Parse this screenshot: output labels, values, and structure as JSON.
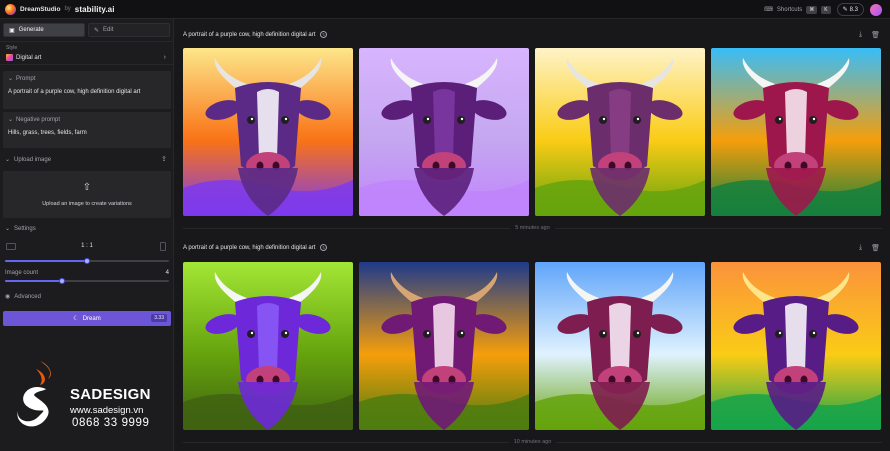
{
  "app": {
    "name": "DreamStudio",
    "by": "by",
    "brand": "stability.ai"
  },
  "topbar": {
    "shortcuts_label": "Shortcuts",
    "shortcut_keys": [
      "⌘",
      "K"
    ],
    "credits": "8.3"
  },
  "sidebar": {
    "tabs": [
      {
        "label": "Generate",
        "icon": "image-icon",
        "active": true
      },
      {
        "label": "Edit",
        "icon": "edit-icon",
        "active": false
      }
    ],
    "style": {
      "label": "Style",
      "value": "Digital art"
    },
    "prompt": {
      "label": "Prompt",
      "value": "A portrait of a purple cow, high definition digital art"
    },
    "negative_prompt": {
      "label": "Negative prompt",
      "value": "Hills, grass, trees, fields, farm"
    },
    "upload": {
      "label": "Upload image",
      "hint": "Upload an image to create variations"
    },
    "settings": {
      "label": "Settings",
      "aspect_ratio": "1 : 1",
      "aspect_ratio_fraction": 0.5,
      "image_count_label": "Image count",
      "image_count": "4",
      "image_count_fraction": 0.35
    },
    "advanced_label": "Advanced",
    "dream_button": {
      "label": "Dream",
      "cost": "3.33"
    }
  },
  "watermark": {
    "brand": "SADESIGN",
    "website": "www.sadesign.vn",
    "phone": "0868 33 9999"
  },
  "generations": [
    {
      "prompt": "A portrait of a purple cow, high definition digital art",
      "time": "5 minutes ago",
      "images": [
        {
          "bg": [
            "#fde68a",
            "#f97316",
            "#7c3aed"
          ],
          "cow": "#5b2a86",
          "face": "#ffffff",
          "horn": "#e7e5e4"
        },
        {
          "bg": [
            "#d8b4fe",
            "#c4a7f0",
            "#c084fc"
          ],
          "cow": "#5b1f7a",
          "face": "#7e3aa5",
          "horn": "#f5f5f4"
        },
        {
          "bg": [
            "#fef3c7",
            "#facc15",
            "#65a30d"
          ],
          "cow": "#6b2d6b",
          "face": "#8b3f86",
          "horn": "#e7e5e4"
        },
        {
          "bg": [
            "#38bdf8",
            "#f59e0b",
            "#15803d"
          ],
          "cow": "#9d174d",
          "face": "#fdf2f8",
          "horn": "#f5f5f4"
        }
      ]
    },
    {
      "prompt": "A portrait of a purple cow, high definition digital art",
      "time": "10 minutes ago",
      "images": [
        {
          "bg": [
            "#a3e635",
            "#65a30d",
            "#3f6212"
          ],
          "cow": "#6d28d9",
          "face": "#8b5cf6",
          "horn": "#f5f5f4"
        },
        {
          "bg": [
            "#1e3a8a",
            "#f59e0b",
            "#4d7c0f"
          ],
          "cow": "#701a75",
          "face": "#fce7f3",
          "horn": "#d6a574"
        },
        {
          "bg": [
            "#60a5fa",
            "#e0f2fe",
            "#65a30d"
          ],
          "cow": "#7e1d4f",
          "face": "#fdf4ff",
          "horn": "#f5f5f4"
        },
        {
          "bg": [
            "#fb923c",
            "#facc15",
            "#16a34a"
          ],
          "cow": "#581c87",
          "face": "#ffffff",
          "horn": "#fde68a"
        }
      ]
    }
  ]
}
